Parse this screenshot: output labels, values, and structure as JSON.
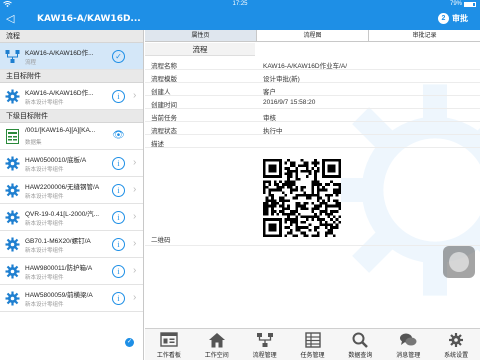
{
  "status": {
    "time": "17:25",
    "battery": "79%",
    "battery_level": 0.79
  },
  "nav": {
    "title": "KAW16-A/KAW16D...",
    "approve_label": "审批",
    "approve_badge": "2"
  },
  "sidebar": {
    "sections": [
      {
        "header": "流程",
        "items": [
          {
            "title": "KAW16-A/KAW16D作...",
            "subtitle": "流程",
            "icon": "flow-icon",
            "action": "verified-icon",
            "selected": true
          }
        ]
      },
      {
        "header": "主目标附件",
        "items": [
          {
            "title": "KAW16-A/KAW16D作...",
            "subtitle": "新本设计零组件",
            "icon": "gear-icon",
            "action": "info-icon"
          }
        ]
      },
      {
        "header": "下级目标附件",
        "items": [
          {
            "title": "/001/[KAW16-A][A][KA...",
            "subtitle": "数据集",
            "icon": "excel-icon",
            "action": "preview-icon"
          },
          {
            "title": "HAW0500010/底板/A",
            "subtitle": "新本设计零组件",
            "icon": "gear-icon",
            "action": "info-icon"
          },
          {
            "title": "HAW2200006/无缝钢管/A",
            "subtitle": "新本设计零组件",
            "icon": "gear-icon",
            "action": "info-icon"
          },
          {
            "title": "QVR-19-0.41[L-2000/汽...",
            "subtitle": "新本设计零组件",
            "icon": "gear-icon",
            "action": "info-icon"
          },
          {
            "title": "GB70.1-M6X20/螺钉/A",
            "subtitle": "新本设计零组件",
            "icon": "gear-icon",
            "action": "info-icon"
          },
          {
            "title": "HAW9800011/防护箱/A",
            "subtitle": "新本设计零组件",
            "icon": "gear-icon",
            "action": "info-icon"
          },
          {
            "title": "HAW5800059/前横梁/A",
            "subtitle": "新本设计零组件",
            "icon": "gear-icon",
            "action": "info-icon"
          }
        ]
      }
    ]
  },
  "tabs": [
    {
      "label": "属性页",
      "active": true
    },
    {
      "label": "流程图"
    },
    {
      "label": "审批记录"
    }
  ],
  "panel": {
    "title": "流程",
    "rows": [
      {
        "key": "流程名称",
        "value": "KAW16-A/KAW16D作业车/A/"
      },
      {
        "key": "流程模版",
        "value": "设计审批(新)"
      },
      {
        "key": "创建人",
        "value": "客户"
      },
      {
        "key": "创建时间",
        "value": "2016/9/7 15:58:20"
      },
      {
        "key": "当前任务",
        "value": "审核"
      },
      {
        "key": "流程状态",
        "value": "执行中"
      },
      {
        "key": "描述",
        "value": ""
      }
    ],
    "qr_label": "二维码"
  },
  "tabbar": [
    {
      "label": "工作看板",
      "icon": "dashboard-icon"
    },
    {
      "label": "工作空间",
      "icon": "home-icon"
    },
    {
      "label": "流程管理",
      "icon": "flow-icon"
    },
    {
      "label": "任务管理",
      "icon": "task-icon"
    },
    {
      "label": "数据查询",
      "icon": "search-icon"
    },
    {
      "label": "消息管理",
      "icon": "message-icon"
    },
    {
      "label": "系统设置",
      "icon": "gear-icon"
    }
  ],
  "colors": {
    "accent": "#1e8fe6",
    "selected_row": "#d4e7f8",
    "icon_blue": "#1e7fd0"
  }
}
